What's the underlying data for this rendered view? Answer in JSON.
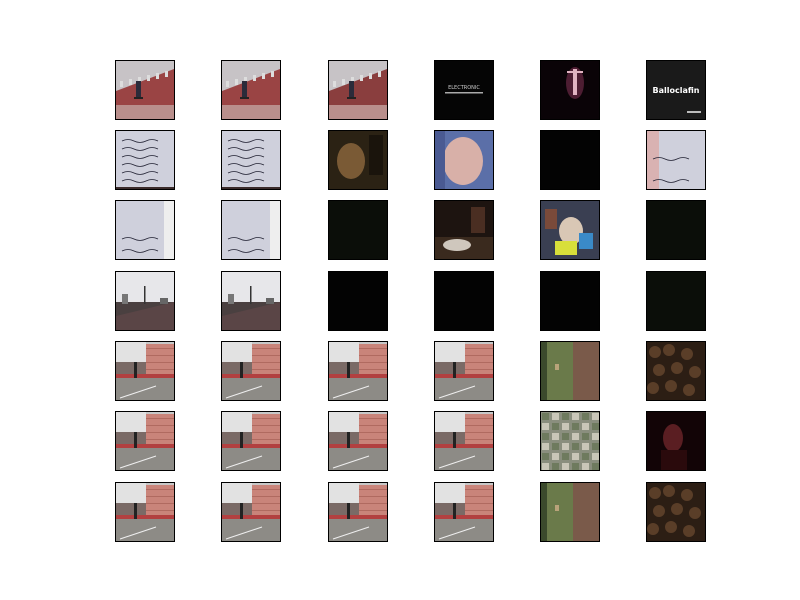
{
  "figure": {
    "rows": 7,
    "cols": 6,
    "frames": [
      [
        "brick-street-skateboarder",
        "brick-street-skateboarder",
        "brick-street-skateboarder-dim",
        "black-title-text",
        "dark-stage-dancer",
        "dark-title-logo"
      ],
      [
        "handwritten-note",
        "handwritten-note",
        "dark-face-closeup",
        "face-closeup-blue",
        "black",
        "handwritten-note-partial"
      ],
      [
        "handwritten-note-2",
        "handwritten-note-2",
        "very-dark",
        "dark-room-shoes",
        "colorful-toys",
        "very-dark"
      ],
      [
        "street-pole-dusk",
        "street-pole-dusk",
        "black",
        "black",
        "black",
        "very-dark"
      ],
      [
        "courtyard-skater",
        "courtyard-skater",
        "courtyard-skater",
        "courtyard-skater",
        "blurry-door",
        "crowd-dark"
      ],
      [
        "courtyard-skater",
        "courtyard-skater",
        "courtyard-skater",
        "courtyard-skater",
        "aerial-city",
        "dark-portrait-red"
      ],
      [
        "courtyard-skater",
        "courtyard-skater",
        "courtyard-skater",
        "courtyard-skater",
        "blurry-door",
        "crowd-dark"
      ]
    ],
    "title_text_1": "ELECTRONIC",
    "title_text_2": "Balloclafin"
  }
}
